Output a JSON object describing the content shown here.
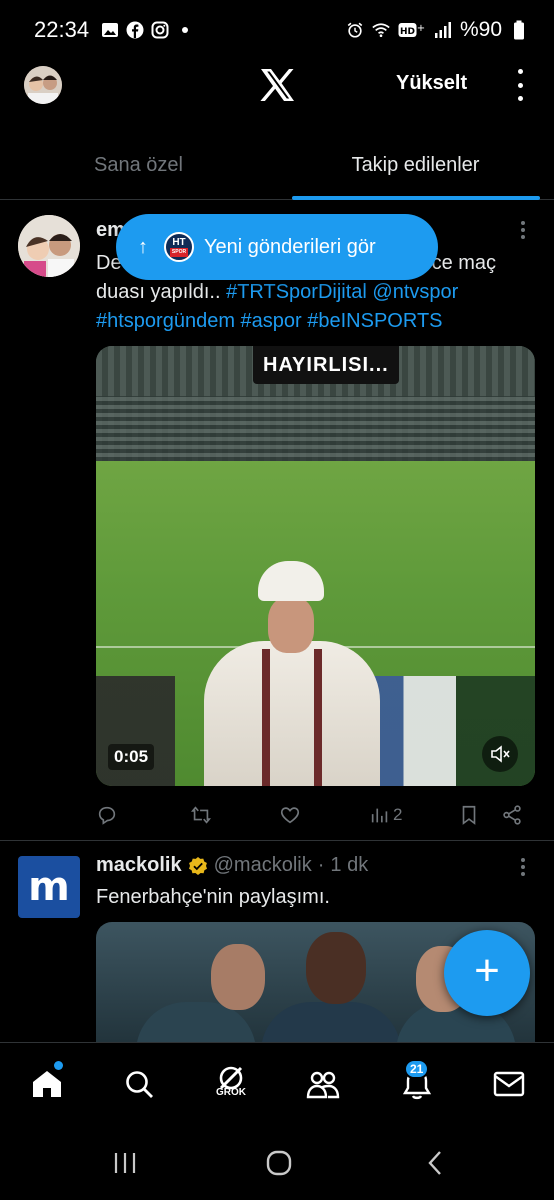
{
  "status_bar": {
    "time": "22:34",
    "battery": "%90"
  },
  "header": {
    "upgrade_label": "Yükselt"
  },
  "tabs": [
    {
      "label": "Sana özel",
      "active": false
    },
    {
      "label": "Takip edilenler",
      "active": true
    }
  ],
  "toast": {
    "label": "Yeni gönderileri gör",
    "avatar_text": "HT",
    "avatar_sub": "SPOR"
  },
  "post1": {
    "author": "em",
    "text_line1_start": "De",
    "text_line1_end": "ce maç",
    "text_line2_plain": "duası yapıldı.. ",
    "hashtags_line2": "#TRTSporDijital @ntvspor",
    "hashtags_line3": "#htsporgündem #aspor #beINSPORTS",
    "video_caption": "HAYIRLISI...",
    "video_time": "0:05",
    "views": "2"
  },
  "post2": {
    "author": "mackolik",
    "handle": "@mackolik",
    "separator": "·",
    "time": "1 dk",
    "text": "Fenerbahçe'nin paylaşımı.",
    "avatar_letter": "m"
  },
  "bottom_nav": {
    "grok_label": "GROK",
    "notifications_count": "21"
  },
  "colors": {
    "accent": "#1d9bf0",
    "background": "#000000",
    "muted": "#71767b",
    "verified": "#e8b71a"
  }
}
